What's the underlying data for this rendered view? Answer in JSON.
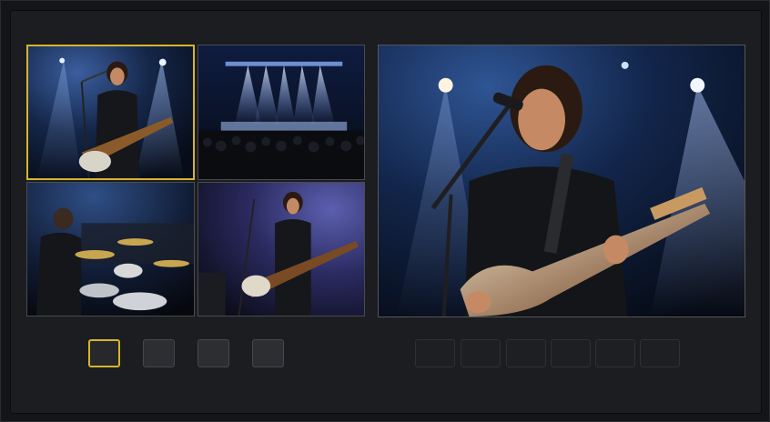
{
  "colors": {
    "selection": "#d7b52a",
    "panel": "#1b1d21",
    "button": "#2c2e32",
    "slot": "#1d1f23"
  },
  "sources": [
    {
      "id": "source-1",
      "scene": "guitarist-singing-wide",
      "selected": true
    },
    {
      "id": "source-2",
      "scene": "stage-crowd-wide",
      "selected": false
    },
    {
      "id": "source-3",
      "scene": "drummer",
      "selected": false
    },
    {
      "id": "source-4",
      "scene": "bassist-purple",
      "selected": false
    }
  ],
  "program": {
    "scene": "guitarist-singing-closeup"
  },
  "source_buttons": [
    {
      "active": true
    },
    {
      "active": false
    },
    {
      "active": false
    },
    {
      "active": false
    }
  ],
  "preset_slots": [
    {
      "empty": true
    },
    {
      "empty": true
    },
    {
      "empty": true
    },
    {
      "empty": true
    },
    {
      "empty": true
    },
    {
      "empty": true
    }
  ]
}
